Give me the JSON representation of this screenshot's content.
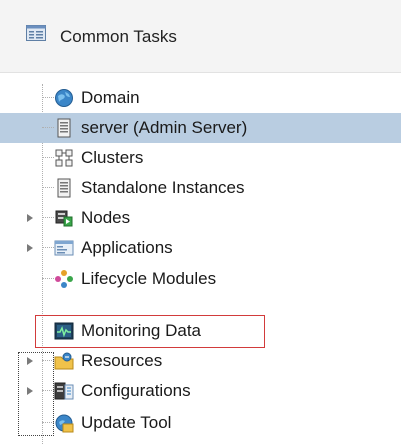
{
  "header": {
    "title": "Common Tasks",
    "icon": "task-list-icon"
  },
  "tree": {
    "items": [
      {
        "label": "Domain",
        "icon": "domain-globe-icon"
      },
      {
        "label": "server (Admin Server)",
        "icon": "server-icon",
        "selected": true
      },
      {
        "label": "Clusters",
        "icon": "clusters-icon"
      },
      {
        "label": "Standalone Instances",
        "icon": "server-icon"
      },
      {
        "label": "Nodes",
        "icon": "nodes-icon",
        "expandable": true
      },
      {
        "label": "Applications",
        "icon": "applications-icon",
        "expandable": true
      },
      {
        "label": "Lifecycle Modules",
        "icon": "lifecycle-modules-icon"
      },
      {
        "label": "Monitoring Data",
        "icon": "monitoring-icon",
        "highlighted": true
      },
      {
        "label": "Resources",
        "icon": "resources-icon",
        "expandable": true
      },
      {
        "label": "Configurations",
        "icon": "configurations-icon",
        "expandable": true,
        "focused": true
      },
      {
        "label": "Update Tool",
        "icon": "update-tool-icon"
      }
    ]
  },
  "colors": {
    "selection": "#b9cde1",
    "highlight_border": "#d23b3b",
    "header_bg": "#f4f4f4"
  }
}
